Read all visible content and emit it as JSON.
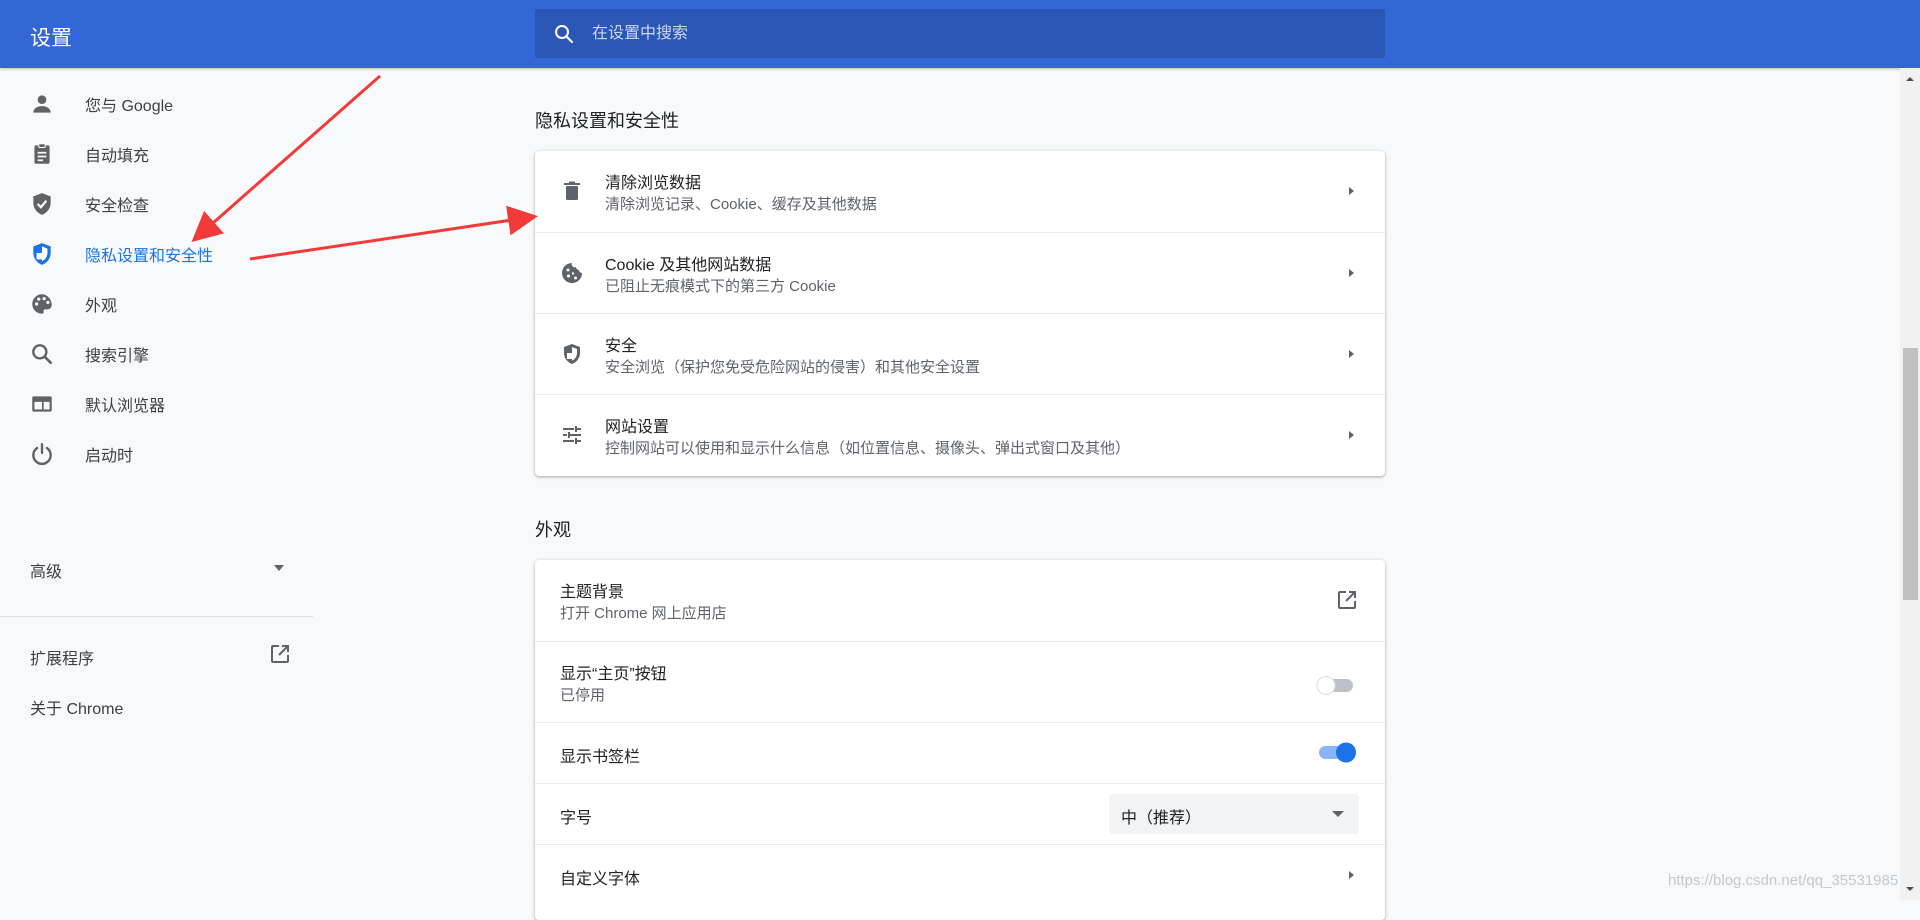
{
  "header": {
    "app_title": "设置",
    "search_placeholder": "在设置中搜索",
    "search_icon": "search-icon"
  },
  "sidebar": {
    "items": [
      {
        "label": "您与 Google",
        "icon": "person-icon"
      },
      {
        "label": "自动填充",
        "icon": "clipboard-icon"
      },
      {
        "label": "安全检查",
        "icon": "shield-check-icon"
      },
      {
        "label": "隐私设置和安全性",
        "icon": "privacy-shield-icon",
        "active": true
      },
      {
        "label": "外观",
        "icon": "palette-icon"
      },
      {
        "label": "搜索引擎",
        "icon": "search-icon"
      },
      {
        "label": "默认浏览器",
        "icon": "browser-window-icon"
      },
      {
        "label": "启动时",
        "icon": "power-icon"
      }
    ],
    "advanced_label": "高级",
    "extensions_label": "扩展程序",
    "about_label": "关于 Chrome"
  },
  "privacy": {
    "title": "隐私设置和安全性",
    "rows": [
      {
        "title": "清除浏览数据",
        "sub": "清除浏览记录、Cookie、缓存及其他数据",
        "icon": "trash-icon"
      },
      {
        "title": "Cookie 及其他网站数据",
        "sub": "已阻止无痕模式下的第三方 Cookie",
        "icon": "cookie-icon"
      },
      {
        "title": "安全",
        "sub": "安全浏览（保护您免受危险网站的侵害）和其他安全设置",
        "icon": "security-shield-icon"
      },
      {
        "title": "网站设置",
        "sub": "控制网站可以使用和显示什么信息（如位置信息、摄像头、弹出式窗口及其他）",
        "icon": "tune-sliders-icon"
      }
    ]
  },
  "appearance": {
    "title": "外观",
    "theme": {
      "title": "主题背景",
      "sub": "打开 Chrome 网上应用店"
    },
    "home_button": {
      "title": "显示“主页”按钮",
      "sub": "已停用",
      "enabled": false
    },
    "bookmarks_bar": {
      "title": "显示书签栏",
      "enabled": true
    },
    "font_size": {
      "title": "字号",
      "value": "中（推荐）"
    },
    "custom_fonts": {
      "title": "自定义字体"
    }
  },
  "colors": {
    "header_bg": "#3367d6",
    "search_bg": "#2a56b6",
    "active_blue": "#1a73e8",
    "annotation_red": "#f23a3a"
  },
  "watermark": "https://blog.csdn.net/qq_35531985"
}
